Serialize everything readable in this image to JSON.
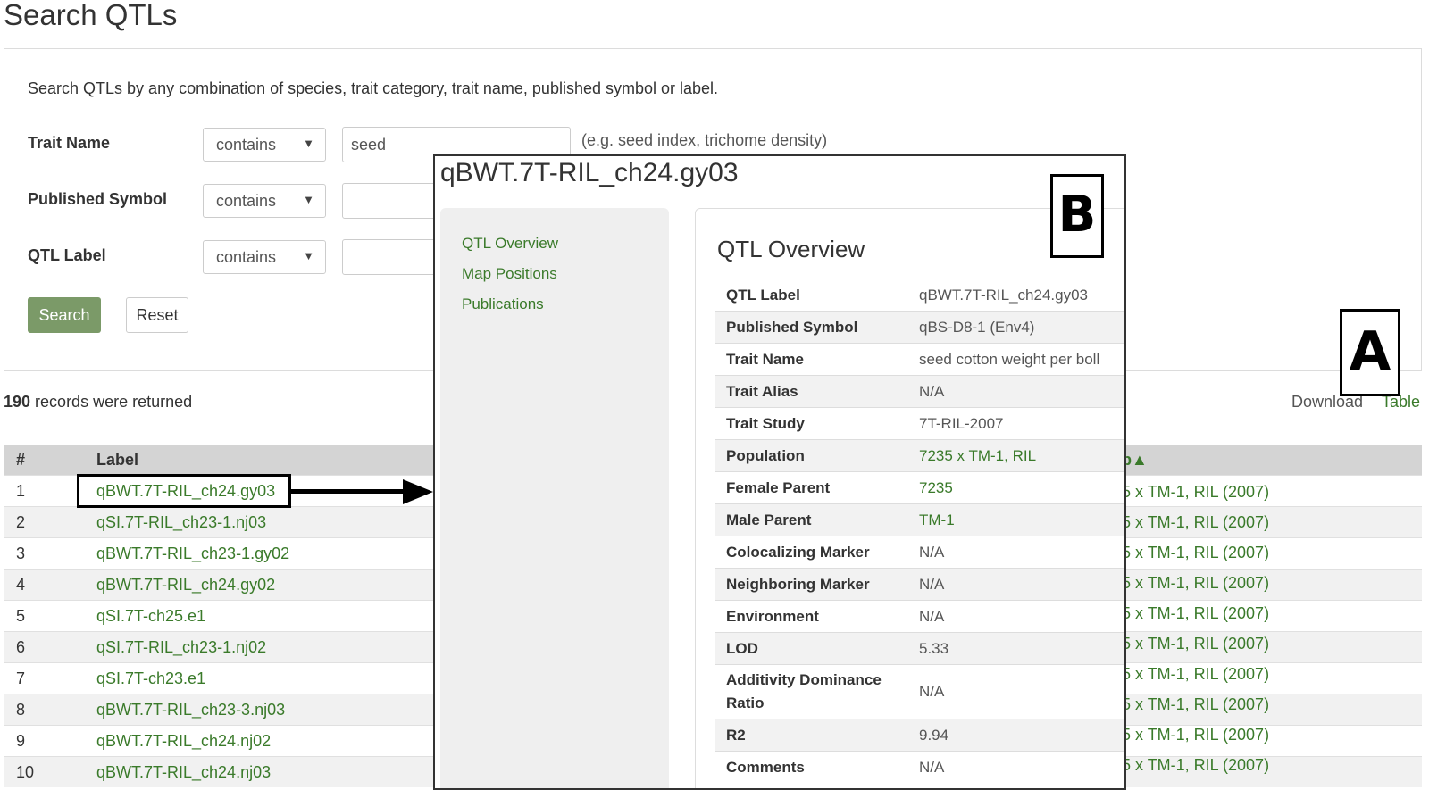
{
  "page": {
    "title": "Search QTLs"
  },
  "search": {
    "intro": "Search QTLs by any combination of species, trait category, trait name, published symbol or label.",
    "fields": [
      {
        "label": "Trait Name",
        "operator": "contains",
        "value": "seed"
      },
      {
        "label": "Published Symbol",
        "operator": "contains",
        "value": ""
      },
      {
        "label": "QTL Label",
        "operator": "contains",
        "value": ""
      }
    ],
    "hint": "(e.g. seed index, trichome density)",
    "search_button": "Search",
    "reset_button": "Reset"
  },
  "results": {
    "count": "190",
    "count_suffix": " records were returned",
    "download_label": "Download",
    "table_link": "Table",
    "columns": {
      "num": "#",
      "label": "Label",
      "population_fragment": "p▲"
    },
    "rows": [
      {
        "num": "1",
        "label": "qBWT.7T-RIL_ch24.gy03",
        "population": "5 x TM-1, RIL (2007)"
      },
      {
        "num": "2",
        "label": "qSI.7T-RIL_ch23-1.nj03",
        "population": "5 x TM-1, RIL (2007)"
      },
      {
        "num": "3",
        "label": "qBWT.7T-RIL_ch23-1.gy02",
        "population": "5 x TM-1, RIL (2007)"
      },
      {
        "num": "4",
        "label": "qBWT.7T-RIL_ch24.gy02",
        "population": "5 x TM-1, RIL (2007)"
      },
      {
        "num": "5",
        "label": "qSI.7T-ch25.e1",
        "population": "5 x TM-1, RIL (2007)"
      },
      {
        "num": "6",
        "label": "qSI.7T-RIL_ch23-1.nj02",
        "population": "5 x TM-1, RIL (2007)"
      },
      {
        "num": "7",
        "label": "qSI.7T-ch23.e1",
        "population": "5 x TM-1, RIL (2007)"
      },
      {
        "num": "8",
        "label": "qBWT.7T-RIL_ch23-3.nj03",
        "population": "5 x TM-1, RIL (2007)"
      },
      {
        "num": "9",
        "label": "qBWT.7T-RIL_ch24.nj02",
        "population": "5 x TM-1, RIL (2007)"
      },
      {
        "num": "10",
        "label": "qBWT.7T-RIL_ch24.nj03",
        "population": "5 x TM-1, RIL (2007)"
      }
    ]
  },
  "annotations": {
    "a": "A",
    "b": "B"
  },
  "detail": {
    "title": "qBWT.7T-RIL_ch24.gy03",
    "nav": [
      "QTL Overview",
      "Map Positions",
      "Publications"
    ],
    "heading": "QTL Overview",
    "rows": [
      {
        "key": "QTL Label",
        "value": "qBWT.7T-RIL_ch24.gy03"
      },
      {
        "key": "Published Symbol",
        "value": "qBS-D8-1 (Env4)"
      },
      {
        "key": "Trait Name",
        "value": "seed cotton weight per boll"
      },
      {
        "key": "Trait Alias",
        "value": "N/A"
      },
      {
        "key": "Trait Study",
        "value": "7T-RIL-2007"
      },
      {
        "key": "Population",
        "value": "7235 x TM-1, RIL"
      },
      {
        "key": "Female Parent",
        "value": "7235"
      },
      {
        "key": "Male Parent",
        "value": "TM-1"
      },
      {
        "key": "Colocalizing Marker",
        "value": "N/A"
      },
      {
        "key": "Neighboring Marker",
        "value": "N/A"
      },
      {
        "key": "Environment",
        "value": "N/A"
      },
      {
        "key": "LOD",
        "value": "5.33"
      },
      {
        "key": "Additivity Dominance Ratio",
        "value": "N/A"
      },
      {
        "key": "R2",
        "value": "9.94"
      },
      {
        "key": "Comments",
        "value": "N/A"
      }
    ]
  }
}
